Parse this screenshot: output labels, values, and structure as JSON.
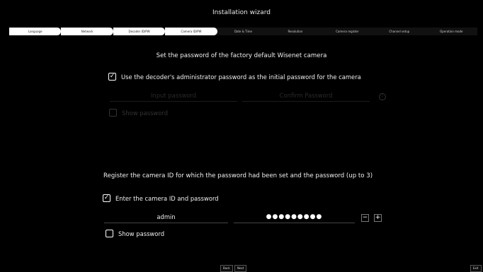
{
  "window": {
    "title": "Installation wizard"
  },
  "steps": [
    {
      "label": "Language"
    },
    {
      "label": "Network"
    },
    {
      "label": "Decoder ID/PW"
    },
    {
      "label": "Camera ID/PW"
    },
    {
      "label": "Date & Time"
    },
    {
      "label": "Resolution"
    },
    {
      "label": "Camera register"
    },
    {
      "label": "Channel setup"
    },
    {
      "label": "Operation mode"
    }
  ],
  "section1": {
    "heading": "Set the password of the factory default Wisenet camera",
    "use_admin_label": "Use the decoder's administrator password as the initial password for the camera",
    "use_admin_checked": true,
    "input_password_placeholder": "Input password",
    "confirm_password_placeholder": "Confirm Password",
    "info_icon": "info-icon",
    "show_password_label": "Show password",
    "show_password_checked": false
  },
  "section2": {
    "heading": "Register the camera ID for which the password had been set and the password (up to 3)",
    "enter_id_label": "Enter the camera ID and password",
    "enter_id_checked": true,
    "camera_id_value": "admin",
    "camera_password_value": "●●●●●●●●●",
    "remove_label": "−",
    "add_label": "+",
    "show_password_label": "Show password",
    "show_password_checked": false
  },
  "footer": {
    "back_label": "Back",
    "next_label": "Next",
    "exit_label": "Exit"
  },
  "colors": {
    "background": "#000000",
    "active_step": "#ffffff",
    "text": "#f0f0f0"
  }
}
